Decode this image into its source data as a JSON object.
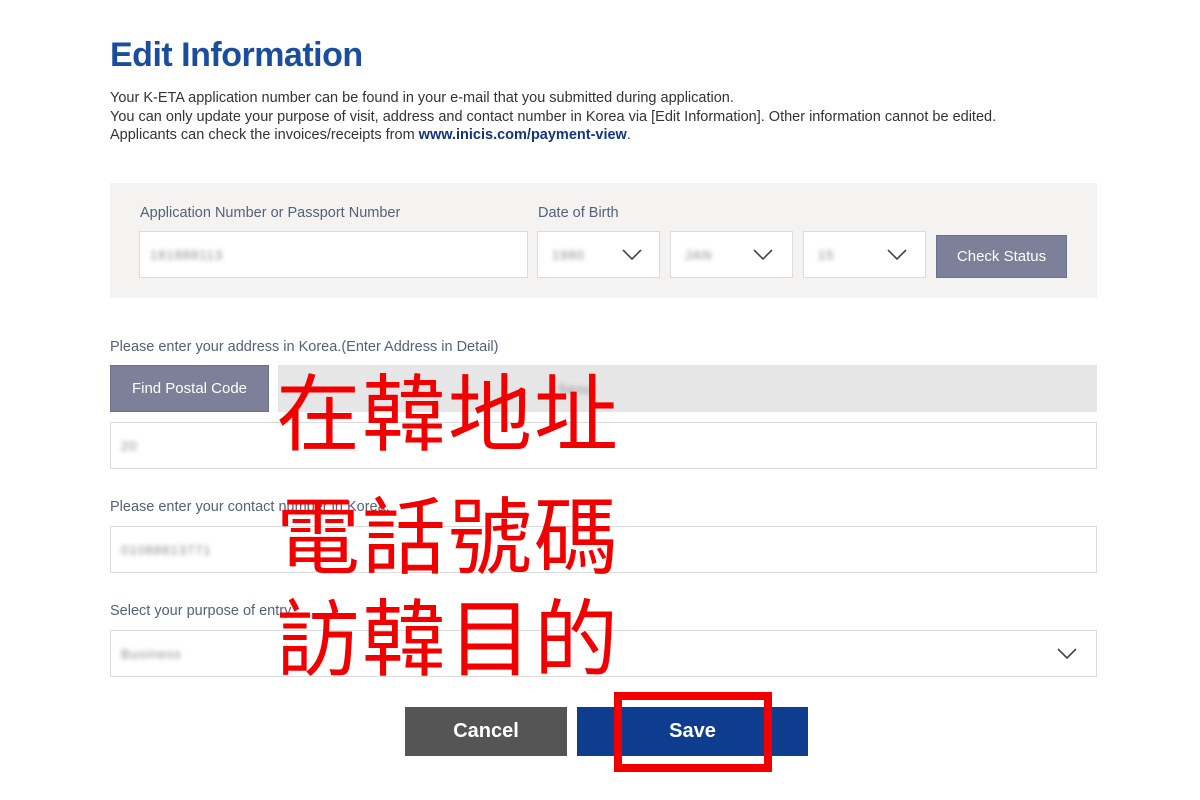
{
  "page": {
    "title": "Edit Information",
    "desc_line1": "Your K-ETA application number can be found in your e-mail that you submitted during application.",
    "desc_line2": "You can only update your purpose of visit, address and contact number in Korea via [Edit Information]. Other information cannot be edited.",
    "desc_line3_prefix": "Applicants can check the invoices/receipts from ",
    "desc_link": "www.inicis.com/payment-view",
    "desc_line3_suffix": "."
  },
  "lookup": {
    "app_label": "Application Number or Passport Number",
    "app_value": "181888113",
    "dob_label": "Date of Birth",
    "dob_year": "1980",
    "dob_month": "JAN",
    "dob_day": "15",
    "check_button": "Check Status"
  },
  "address": {
    "label": "Please enter your address in Korea.(Enter Address in Detail)",
    "find_button": "Find Postal Code",
    "address_value": "Seoul",
    "detail_value": "20"
  },
  "contact": {
    "label": "Please enter your contact number in Korea.",
    "value": "01088813771"
  },
  "purpose": {
    "label": "Select your purpose of entry.",
    "value": "Business"
  },
  "actions": {
    "cancel": "Cancel",
    "save": "Save"
  },
  "annotations": {
    "line1": "在韓地址",
    "line2": "電話號碼",
    "line3": "訪韓目的"
  },
  "colors": {
    "title": "#1a4e9c",
    "save_button": "#0e3d8f",
    "cancel_button": "#555555",
    "secondary_button": "#7c8098",
    "annotation": "#f20000"
  }
}
